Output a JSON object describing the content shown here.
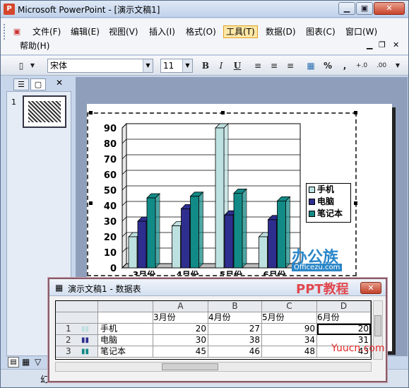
{
  "window": {
    "title": "Microsoft PowerPoint - [演示文稿1]",
    "min": "▁",
    "max": "▣",
    "close": "✕"
  },
  "menu": {
    "items": [
      {
        "label": "文件(F)"
      },
      {
        "label": "编辑(E)"
      },
      {
        "label": "视图(V)"
      },
      {
        "label": "插入(I)"
      },
      {
        "label": "格式(O)"
      },
      {
        "label": "工具(T)"
      },
      {
        "label": "数据(D)"
      },
      {
        "label": "图表(C)"
      },
      {
        "label": "窗口(W)"
      }
    ],
    "help": "帮助(H)",
    "active_index": 5
  },
  "toolbar": {
    "font": "宋体",
    "size": "11",
    "bold": "B",
    "italic": "I",
    "underline": "U",
    "percent": "%",
    "comma": ",",
    "inc_dec": "+.0",
    "dec_dec": ".00"
  },
  "slides": {
    "number": "1"
  },
  "chart_data": {
    "type": "bar",
    "categories": [
      "3月份",
      "4月份",
      "5月份",
      "6月份"
    ],
    "series": [
      {
        "name": "手机",
        "values": [
          20,
          27,
          90,
          20
        ],
        "color": "#bde0e0"
      },
      {
        "name": "电脑",
        "values": [
          30,
          38,
          34,
          31
        ],
        "color": "#2e2e8f"
      },
      {
        "name": "笔记本",
        "values": [
          45,
          46,
          48,
          43
        ],
        "color": "#128a86"
      }
    ],
    "ylim": [
      0,
      90
    ],
    "yticks": [
      "0",
      "10",
      "20",
      "30",
      "40",
      "50",
      "60",
      "70",
      "80",
      "90"
    ],
    "grid": true,
    "legend": "right"
  },
  "datasheet": {
    "title": "演示文稿1 - 数据表",
    "col_letters": [
      "A",
      "B",
      "C",
      "D"
    ],
    "headers": [
      "3月份",
      "4月份",
      "5月份",
      "6月份"
    ],
    "rows": [
      {
        "num": "1",
        "label": "手机",
        "values": [
          "20",
          "27",
          "90",
          "20"
        ]
      },
      {
        "num": "2",
        "label": "电脑",
        "values": [
          "30",
          "38",
          "34",
          "31"
        ]
      },
      {
        "num": "3",
        "label": "笔记本",
        "values": [
          "45",
          "46",
          "48",
          "43"
        ]
      }
    ]
  },
  "watermark": {
    "brand": "办公族",
    "site": "Officezu.com",
    "tutorial": "PPT教程",
    "yuucn": "Yuucn.com"
  },
  "status": {
    "text": "幻"
  }
}
